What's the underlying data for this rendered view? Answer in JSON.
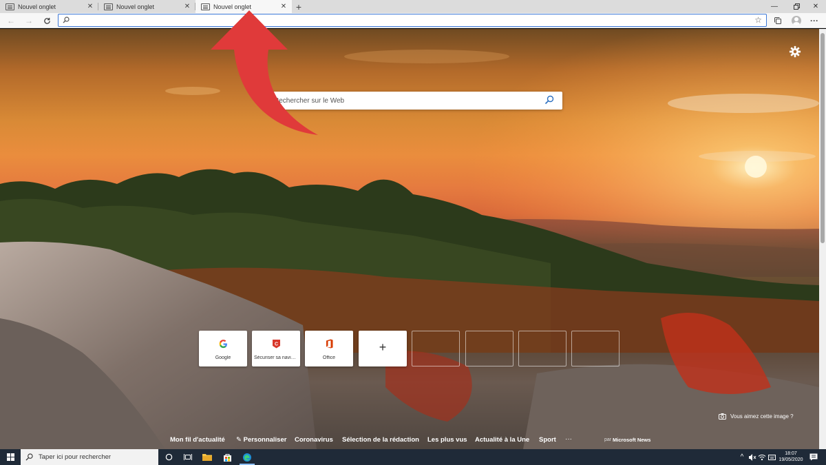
{
  "tabs": [
    {
      "label": "Nouvel onglet",
      "active": false
    },
    {
      "label": "Nouvel onglet",
      "active": false
    },
    {
      "label": "Nouvel onglet",
      "active": true
    }
  ],
  "toolbar": {
    "address_value": "",
    "icons": [
      "back-icon",
      "forward-icon",
      "refresh-icon",
      "favorite-star-icon",
      "collections-icon",
      "profile-icon",
      "more-icon"
    ]
  },
  "ntp": {
    "search_placeholder": "Rechercher sur le Web",
    "quick_links": [
      {
        "label": "Google",
        "icon": "google-icon"
      },
      {
        "label": "Sécuriser sa navigation",
        "icon": "security-icon"
      },
      {
        "label": "Office",
        "icon": "office-icon"
      }
    ],
    "feedback_bg": "Vous aimez cette image ?",
    "news_nav": {
      "items": [
        "Mon fil d'actualité",
        "Personnaliser",
        "Coronavirus",
        "Sélection de la rédaction",
        "Les plus vus",
        "Actualité à la Une",
        "Sport"
      ],
      "more": "···",
      "by": "par",
      "provider": "Microsoft News"
    }
  },
  "taskbar": {
    "search_placeholder": "Taper ici pour rechercher",
    "time": "18:07",
    "date": "19/05/2020"
  },
  "colors": {
    "accent": "#3c78d8",
    "arrow": "#e03a3a",
    "taskbar": "#1f2a38",
    "office": "#d83b01",
    "google_blue": "#4285f4",
    "google_red": "#ea4335",
    "google_yellow": "#fbbc05",
    "google_green": "#34a853"
  }
}
